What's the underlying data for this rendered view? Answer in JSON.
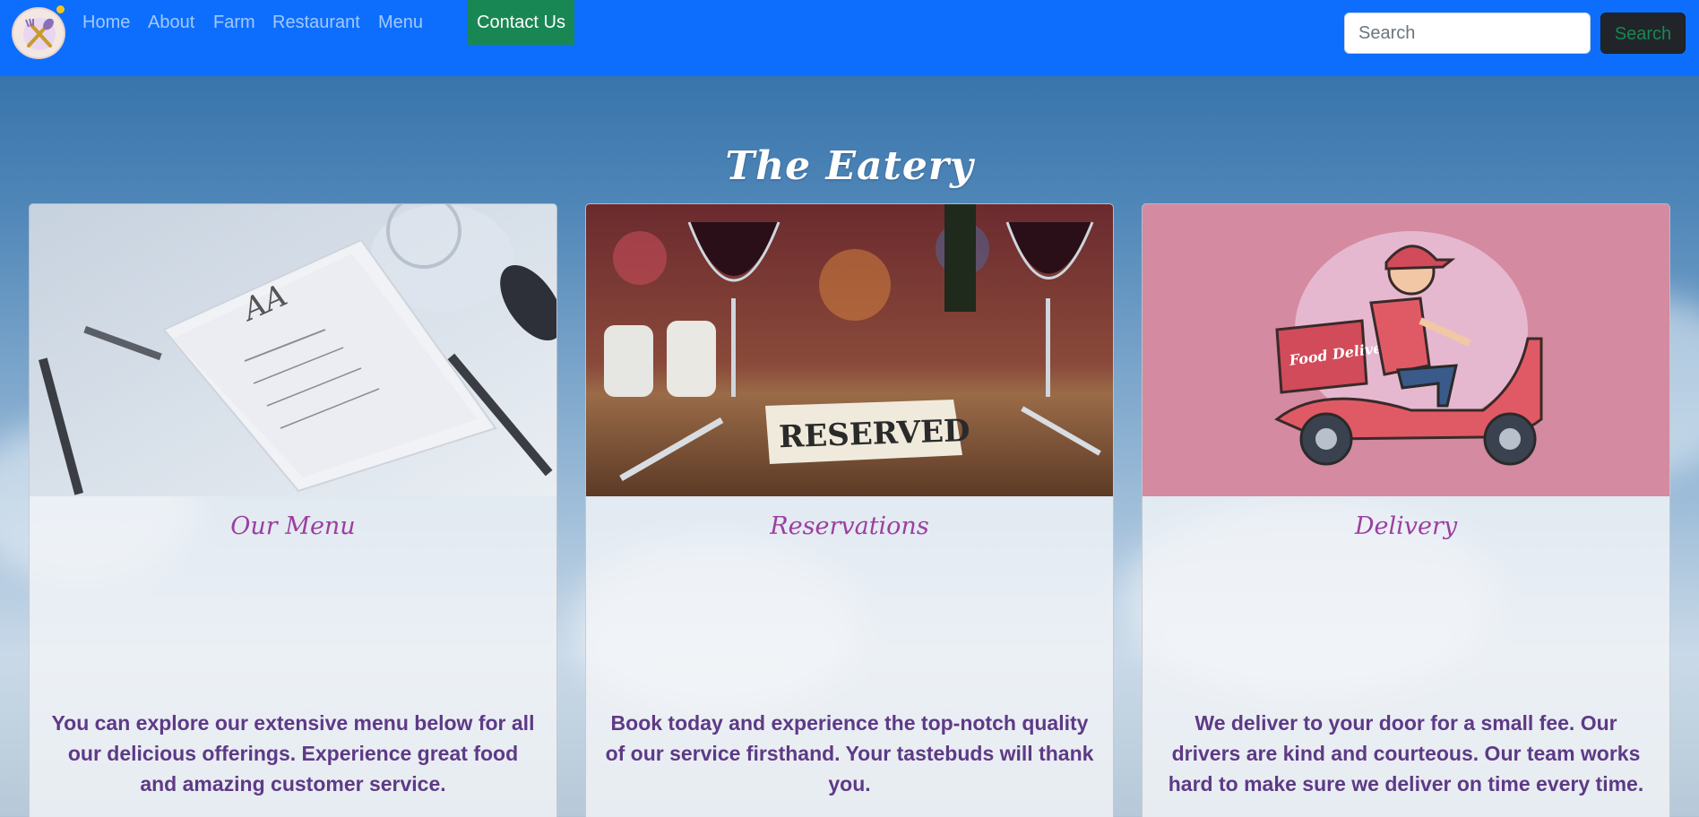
{
  "nav": {
    "links": [
      "Home",
      "About",
      "Farm",
      "Restaurant",
      "Menu"
    ],
    "contact_label": "Contact Us",
    "search_placeholder": "Search",
    "search_button": "Search"
  },
  "page": {
    "title": "The Eatery"
  },
  "cards": [
    {
      "title": "Our Menu",
      "text": "You can explore our extensive menu below for all our delicious offerings. Experience great food and amazing customer service."
    },
    {
      "title": "Reservations",
      "image_sign": "RESERVED",
      "text": "Book today and experience the top-notch quality of our service firsthand. Your tastebuds will thank you."
    },
    {
      "title": "Delivery",
      "image_sign": "Food Delivery",
      "text": "We deliver to your door for a small fee. Our drivers are kind and courteous. Our team works hard to make sure we deliver on time every time."
    }
  ],
  "colors": {
    "navbar": "#0d6efd",
    "contact_button": "#198754",
    "search_button": "#212529",
    "card_title": "#9b3fa0",
    "card_text": "#5e3a86"
  }
}
